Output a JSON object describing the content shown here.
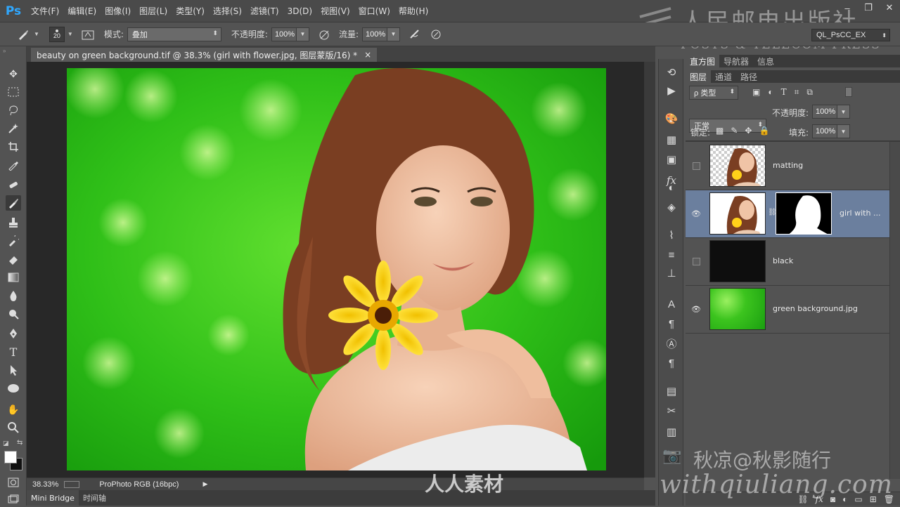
{
  "app": {
    "logo": "Ps"
  },
  "menu": [
    "文件(F)",
    "编辑(E)",
    "图像(I)",
    "图层(L)",
    "类型(Y)",
    "选择(S)",
    "滤镜(T)",
    "3D(D)",
    "视图(V)",
    "窗口(W)",
    "帮助(H)"
  ],
  "window_controls": [
    "–",
    "❐",
    "✕"
  ],
  "options": {
    "brush_size": "20",
    "mode_label": "模式:",
    "mode_value": "叠加",
    "opacity_label": "不透明度:",
    "opacity_value": "100%",
    "flow_label": "流量:",
    "flow_value": "100%",
    "workspace": "QL_PsCC_EX"
  },
  "document": {
    "tab_title": "beauty on green background.tif @ 38.3% (girl with flower.jpg, 图层蒙版/16) *",
    "close": "×"
  },
  "status": {
    "zoom": "38.33%",
    "profile": "ProPhoto RGB (16bpc)"
  },
  "bottom_tabs": [
    "Mini Bridge",
    "时间轴"
  ],
  "panel_tabs_top": [
    "直方图",
    "导航器",
    "信息"
  ],
  "panel_tabs_layers": [
    "图层",
    "通道",
    "路径"
  ],
  "layers_controls": {
    "filter_label": "ρ 类型",
    "blend_mode": "正常",
    "opacity_label": "不透明度:",
    "opacity_value": "100%",
    "lock_label": "锁定:",
    "fill_label": "填充:",
    "fill_value": "100%"
  },
  "layers": [
    {
      "name": "matting",
      "visible": false
    },
    {
      "name": "girl with ...",
      "visible": true,
      "selected": true
    },
    {
      "name": "black",
      "visible": false
    },
    {
      "name": "green background.jpg",
      "visible": true
    }
  ],
  "watermarks": {
    "publisher_cn": "人民邮电出版社",
    "publisher_en": "POSTS & TELECOM PRESS",
    "author": "秋凉@秋影随行",
    "site": "withqiuliang.com",
    "rrsc": "人人素材"
  }
}
